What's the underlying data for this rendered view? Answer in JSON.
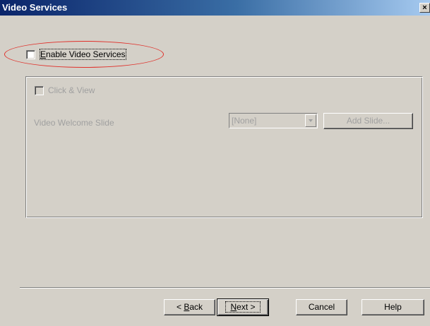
{
  "titlebar": {
    "title": "Video Services",
    "close_glyph": "×"
  },
  "enable_video": {
    "label_mnemonic": "E",
    "label_rest": "nable Video Services",
    "checked": false
  },
  "group": {
    "click_view_label": "Click & View",
    "click_view_checked": false,
    "welcome_slide_label": "Video Welcome Slide",
    "welcome_slide_value": "[None]",
    "add_slide_label": "Add Slide..."
  },
  "footer": {
    "back_prefix": "< ",
    "back_mnemonic": "B",
    "back_rest": "ack",
    "next_mnemonic": "N",
    "next_rest": "ext >",
    "cancel_label": "Cancel",
    "help_label": "Help"
  },
  "annotation": {
    "color": "#e0302a"
  },
  "colors": {
    "dialog_bg": "#d4d0c8",
    "titlebar": "#0a246a",
    "disabled_text": "#a0a0a0"
  }
}
